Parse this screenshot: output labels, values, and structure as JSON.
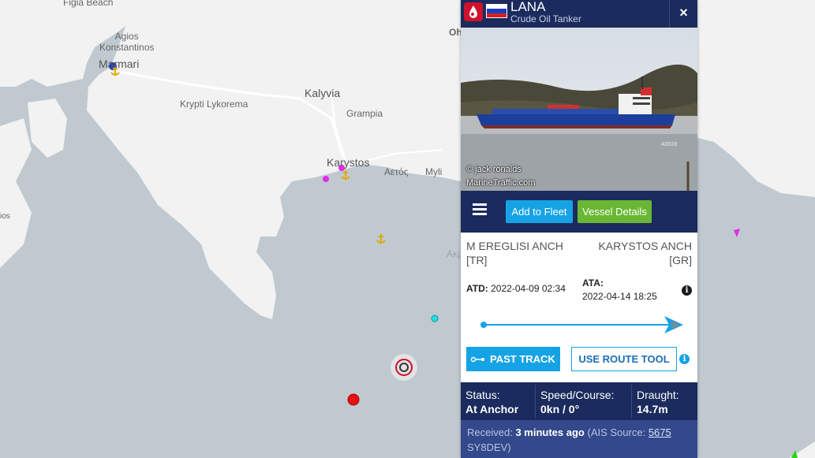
{
  "map": {
    "labels": [
      {
        "name": "label-figia-beach",
        "text": "Figia Beach"
      },
      {
        "name": "label-agios-konstantinos",
        "text": "Agios\nKonstantinos"
      },
      {
        "name": "label-marmari",
        "text": "Marmari"
      },
      {
        "name": "label-kalyvia",
        "text": "Kalyvia"
      },
      {
        "name": "label-krypti-lykorema",
        "text": "Krypti Lykorema"
      },
      {
        "name": "label-grampia",
        "text": "Grampia"
      },
      {
        "name": "label-karystos",
        "text": "Karystos"
      },
      {
        "name": "label-aetos",
        "text": "Αετός"
      },
      {
        "name": "label-myli",
        "text": "Myli"
      },
      {
        "name": "label-ios",
        "text": "ios"
      },
      {
        "name": "label-oh",
        "text": "Oh"
      },
      {
        "name": "label-akr",
        "text": "Ακρ"
      }
    ]
  },
  "panel": {
    "vessel_name": "LANA",
    "vessel_type": "Crude Oil Tanker",
    "flag": "Russia",
    "close": "×",
    "photo_credit_1": "© jack ronalds",
    "photo_credit_2": "MarineTraffic.com",
    "photo_tag": "A0028",
    "menu_icon": "hamburger-menu-icon",
    "add_to_fleet": "Add to Fleet",
    "vessel_details": "Vessel Details",
    "departure_port": "M EREGLISI ANCH",
    "departure_country": "[TR]",
    "arrival_port": "KARYSTOS ANCH",
    "arrival_country": "[GR]",
    "atd_label": "ATD:",
    "atd_value": "2022-04-09 02:34",
    "ata_label": "ATA:",
    "ata_value": "2022-04-14 18:25",
    "past_track": "PAST TRACK",
    "use_route_tool": "USE ROUTE TOOL",
    "status_label": "Status:",
    "status_value": "At Anchor",
    "speed_label": "Speed/Course:",
    "speed_value": "0kn / 0°",
    "draught_label": "Draught:",
    "draught_value": "14.7m",
    "received_label": "Received:",
    "received_value": "3 minutes ago",
    "ais_source_label": "(AIS Source:",
    "ais_source_id": "5675",
    "ais_source_name": "SY8DEV)",
    "progress": 1.0
  },
  "colors": {
    "header": "#1b2b5e",
    "accent_blue": "#16a3e5",
    "accent_green": "#69b734",
    "tanker_red": "#d0112b",
    "sea": "#bfc9cf",
    "land": "#f2f2f2"
  }
}
